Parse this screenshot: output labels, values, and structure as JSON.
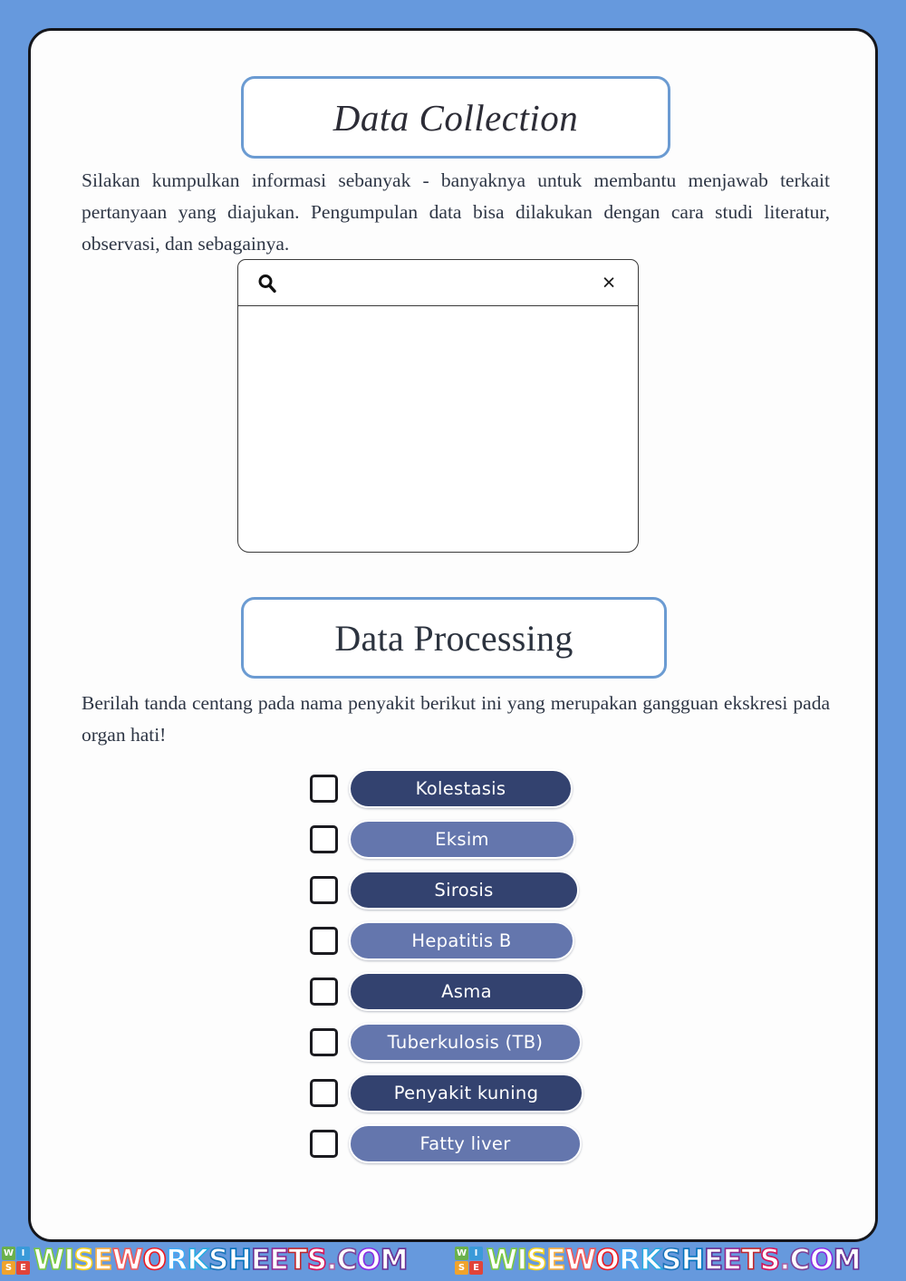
{
  "page": {
    "background_color": "#6699dd",
    "card_background": "#fdfdfd",
    "card_border_color": "#15161b"
  },
  "sections": {
    "data_collection": {
      "header_title": "Data Collection",
      "header_border_color": "#6b9bd2",
      "paragraph": "Silakan kumpulkan informasi sebanyak - banyaknya untuk membantu menjawab terkait pertanyaan yang diajukan. Pengumpulan data bisa dilakukan dengan cara studi literatur, observasi, dan sebagainya."
    },
    "data_processing": {
      "header_title": "Data Processing",
      "header_border_color": "#6b9bd2",
      "paragraph": "Berilah tanda centang pada nama penyakit berikut ini yang merupakan gangguan ekskresi pada organ hati!"
    }
  },
  "answer_panel": {
    "search_icon": "search-icon",
    "clear_icon": "close-icon",
    "clear_glyph": "×",
    "input_value": "",
    "input_placeholder": "",
    "answer_value": "",
    "answer_placeholder": ""
  },
  "disease_list": {
    "pill_color_dark": "#33426f",
    "pill_color_light": "#6476ad",
    "items": [
      {
        "label": "Kolestasis",
        "tone": "dark",
        "checked": false
      },
      {
        "label": "Eksim",
        "tone": "light",
        "checked": false
      },
      {
        "label": "Sirosis",
        "tone": "dark",
        "checked": false
      },
      {
        "label": "Hepatitis B",
        "tone": "light",
        "checked": false
      },
      {
        "label": "Asma",
        "tone": "dark",
        "checked": false
      },
      {
        "label": "Tuberkulosis (TB)",
        "tone": "light",
        "checked": false
      },
      {
        "label": "Penyakit kuning",
        "tone": "dark",
        "checked": false
      },
      {
        "label": "Fatty liver",
        "tone": "light",
        "checked": false
      }
    ]
  },
  "footer": {
    "logo_letters": [
      "W",
      "I",
      "S",
      "E"
    ],
    "watermark_text": "WISEWORKSHEETS.COM",
    "repeat_count": 2,
    "letter_colors": [
      "#7ac943",
      "#8cc63f",
      "#f5d020",
      "#fbb040",
      "#f15a5a",
      "#ed1c24",
      "#3fa9f5",
      "#29abe2",
      "#1b75bb",
      "#0071bc",
      "#662d91",
      "#92278f",
      "#c1272d",
      "#d4145a",
      "#a864a8",
      "#7b4397",
      "#8a2be2",
      "#6a3093"
    ]
  }
}
